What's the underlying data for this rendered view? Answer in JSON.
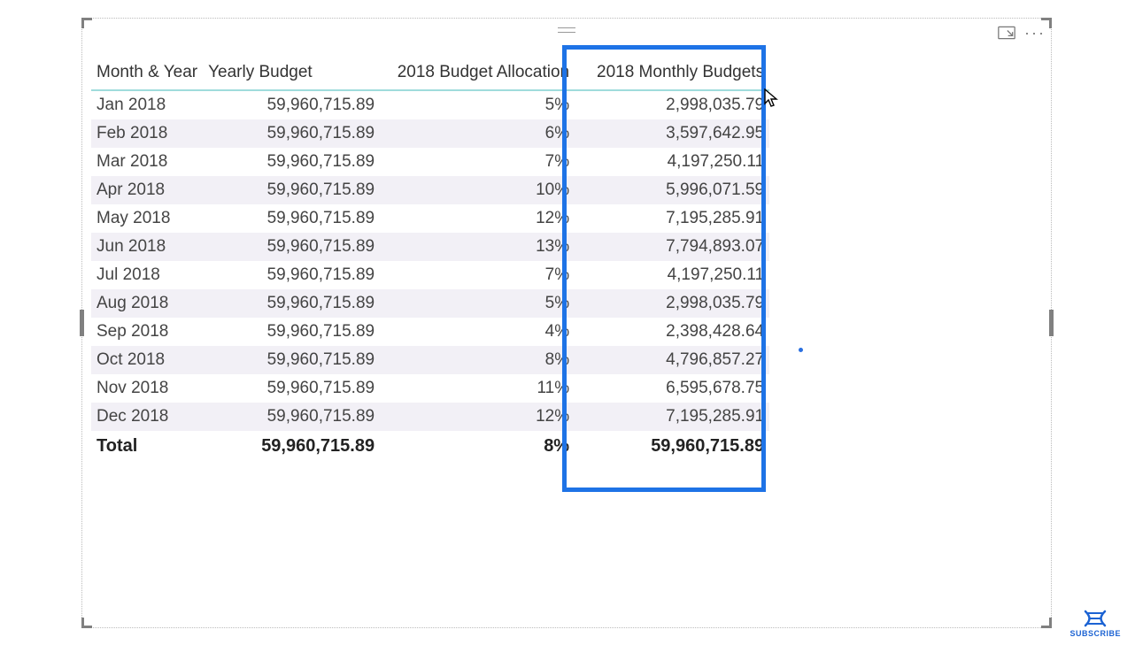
{
  "table": {
    "headers": {
      "month_year": "Month & Year",
      "yearly_budget": "Yearly Budget",
      "allocation": "2018 Budget Allocation",
      "monthly_budget": "2018 Monthly Budgets"
    },
    "rows": [
      {
        "month": "Jan 2018",
        "yearly": "59,960,715.89",
        "alloc": "5%",
        "monthly": "2,998,035.79"
      },
      {
        "month": "Feb 2018",
        "yearly": "59,960,715.89",
        "alloc": "6%",
        "monthly": "3,597,642.95"
      },
      {
        "month": "Mar 2018",
        "yearly": "59,960,715.89",
        "alloc": "7%",
        "monthly": "4,197,250.11"
      },
      {
        "month": "Apr 2018",
        "yearly": "59,960,715.89",
        "alloc": "10%",
        "monthly": "5,996,071.59"
      },
      {
        "month": "May 2018",
        "yearly": "59,960,715.89",
        "alloc": "12%",
        "monthly": "7,195,285.91"
      },
      {
        "month": "Jun 2018",
        "yearly": "59,960,715.89",
        "alloc": "13%",
        "monthly": "7,794,893.07"
      },
      {
        "month": "Jul 2018",
        "yearly": "59,960,715.89",
        "alloc": "7%",
        "monthly": "4,197,250.11"
      },
      {
        "month": "Aug 2018",
        "yearly": "59,960,715.89",
        "alloc": "5%",
        "monthly": "2,998,035.79"
      },
      {
        "month": "Sep 2018",
        "yearly": "59,960,715.89",
        "alloc": "4%",
        "monthly": "2,398,428.64"
      },
      {
        "month": "Oct 2018",
        "yearly": "59,960,715.89",
        "alloc": "8%",
        "monthly": "4,796,857.27"
      },
      {
        "month": "Nov 2018",
        "yearly": "59,960,715.89",
        "alloc": "11%",
        "monthly": "6,595,678.75"
      },
      {
        "month": "Dec 2018",
        "yearly": "59,960,715.89",
        "alloc": "12%",
        "monthly": "7,195,285.91"
      }
    ],
    "total": {
      "label": "Total",
      "yearly": "59,960,715.89",
      "alloc": "8%",
      "monthly": "59,960,715.89"
    }
  },
  "badge": {
    "subscribe": "SUBSCRIBE"
  }
}
